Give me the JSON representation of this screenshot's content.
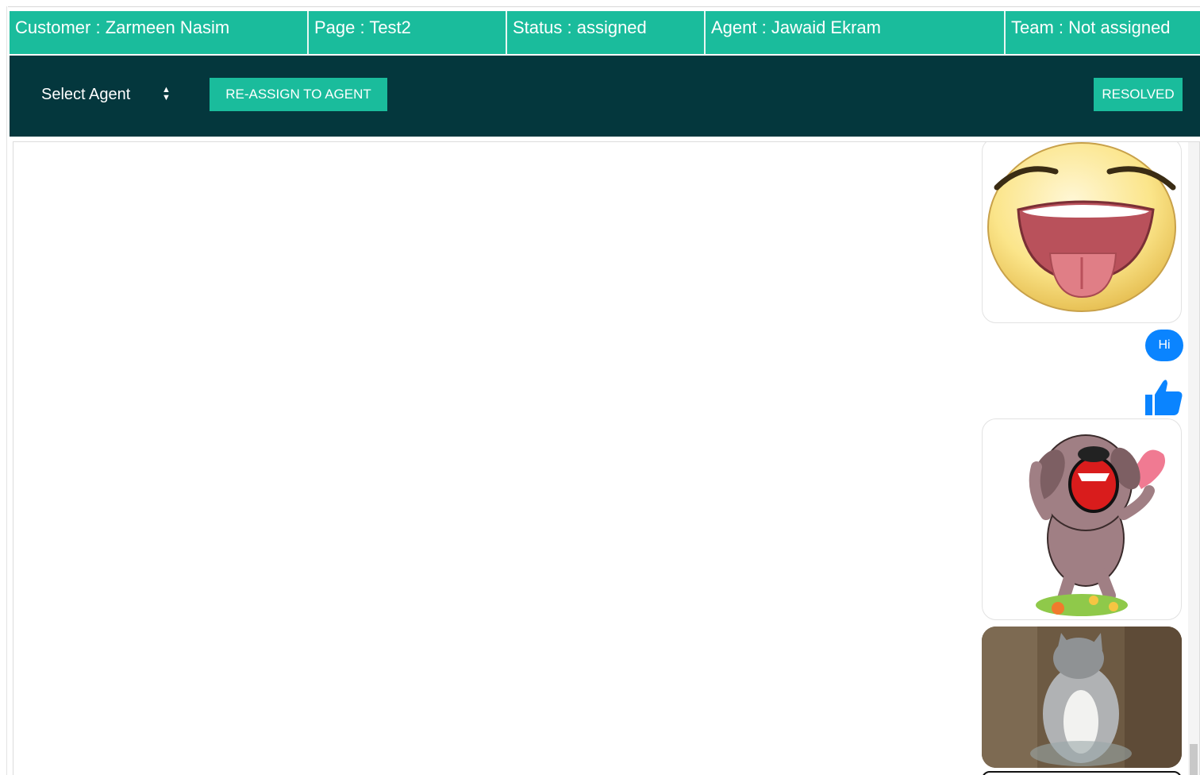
{
  "header": {
    "customer": "Customer : Zarmeen Nasim",
    "page": "Page : Test2",
    "status": "Status : assigned",
    "agent": "Agent : Jawaid Ekram",
    "team": "Team : Not assigned"
  },
  "actions": {
    "select_agent": "Select Agent",
    "reassign_label": "RE-ASSIGN TO AGENT",
    "resolved_label": "RESOLVED"
  },
  "colors": {
    "accent": "#1abc9c",
    "action_bar": "#04373d",
    "bubble": "#0a84ff"
  },
  "messages": [
    {
      "type": "sticker",
      "icon": "laughing-face-sticker"
    },
    {
      "type": "text",
      "text": "Hi"
    },
    {
      "type": "sticker",
      "icon": "thumbs-up-icon"
    },
    {
      "type": "sticker",
      "icon": "dancing-pug-sticker"
    },
    {
      "type": "image",
      "icon": "cat-gif"
    }
  ]
}
